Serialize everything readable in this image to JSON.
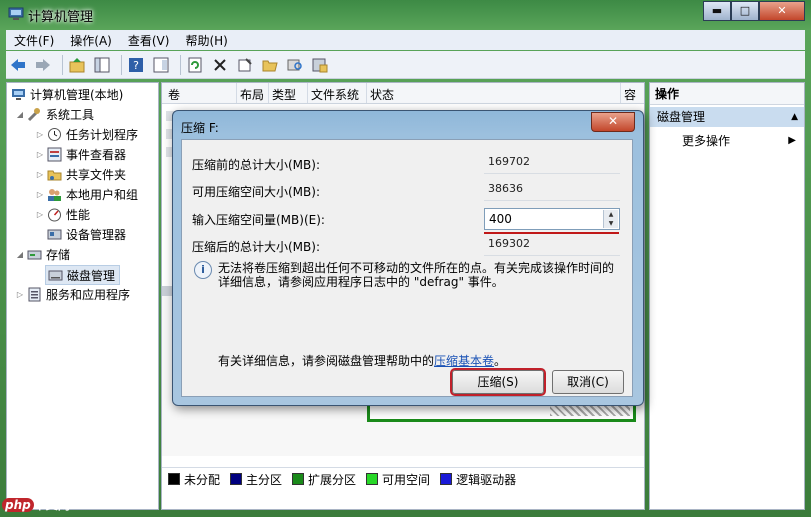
{
  "window": {
    "title": "计算机管理",
    "min": "▬",
    "max": "□",
    "close": "✕"
  },
  "menu": [
    "文件(F)",
    "操作(A)",
    "查看(V)",
    "帮助(H)"
  ],
  "tree": {
    "root": "计算机管理(本地)",
    "system_tools": "系统工具",
    "items": [
      "任务计划程序",
      "事件查看器",
      "共享文件夹",
      "本地用户和组",
      "性能",
      "设备管理器"
    ],
    "storage": "存储",
    "disk_mgmt": "磁盘管理",
    "services": "服务和应用程序"
  },
  "columns": [
    "卷",
    "布局",
    "类型",
    "文件系统",
    "状态",
    "容"
  ],
  "legend": [
    "未分配",
    "主分区",
    "扩展分区",
    "可用空间",
    "逻辑驱动器"
  ],
  "legend_colors": [
    "#000000",
    "#00007f",
    "#1a8a1a",
    "#28d828",
    "#1a1ad8"
  ],
  "actions": {
    "header": "操作",
    "section": "磁盘管理",
    "more": "更多操作"
  },
  "dialog": {
    "title": "压缩 F:",
    "close": "✕",
    "total_before_label": "压缩前的总计大小(MB):",
    "total_before_value": "169702",
    "available_label": "可用压缩空间大小(MB):",
    "available_value": "38636",
    "input_label": "输入压缩空间量(MB)(E):",
    "input_value": "400",
    "total_after_label": "压缩后的总计大小(MB):",
    "total_after_value": "169302",
    "info": "无法将卷压缩到超出任何不可移动的文件所在的点。有关完成该操作时间的详细信息，请参阅应用程序日志中的 \"defrag\" 事件。",
    "more_prefix": "有关详细信息，请参阅磁盘管理帮助中的",
    "more_link": "压缩基本卷",
    "more_suffix": "。",
    "ok": "压缩(S)",
    "cancel": "取消(C)"
  },
  "watermark": {
    "badge": "php",
    "text": "中文网"
  }
}
